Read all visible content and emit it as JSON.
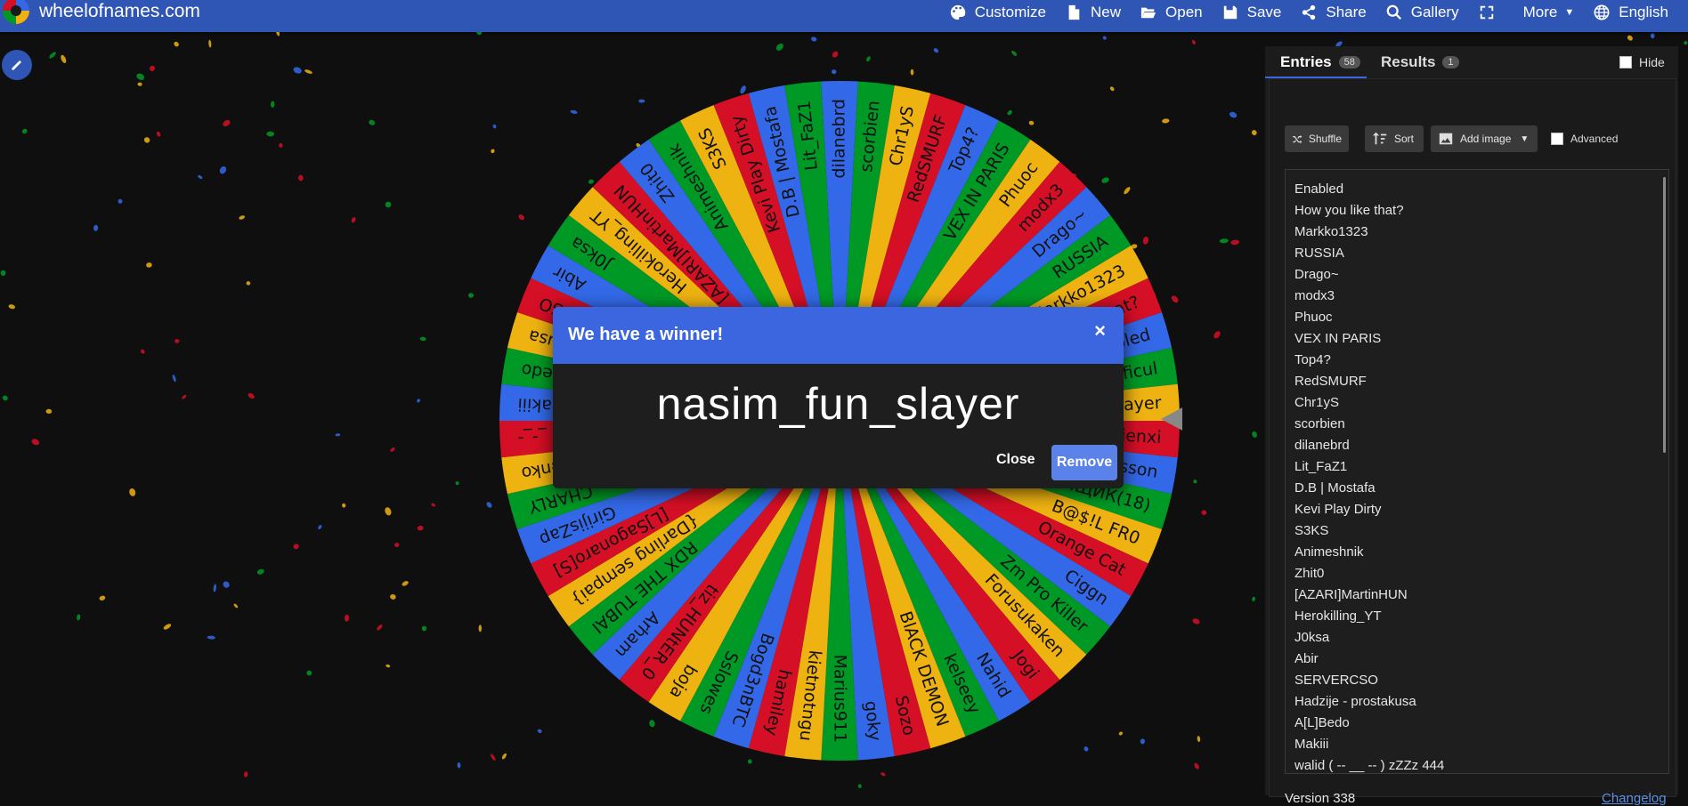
{
  "site": {
    "name": "wheelofnames.com"
  },
  "menu": [
    {
      "label": "Customize",
      "icon": "palette-icon"
    },
    {
      "label": "New",
      "icon": "file-icon"
    },
    {
      "label": "Open",
      "icon": "folder-open-icon"
    },
    {
      "label": "Save",
      "icon": "save-icon"
    },
    {
      "label": "Share",
      "icon": "share-icon"
    },
    {
      "label": "Gallery",
      "icon": "search-icon"
    },
    {
      "label": "",
      "icon": "fullscreen-icon"
    },
    {
      "label": "More",
      "icon": "chevron-down-icon"
    },
    {
      "label": "English",
      "icon": "globe-icon"
    }
  ],
  "colors": {
    "brand": "#2f55b5",
    "wheel": [
      "#3369e8",
      "#009925",
      "#eeb211",
      "#d50f25"
    ],
    "dialog_header": "#3b66e0"
  },
  "wheel": {
    "labels": [
      "dilanebrd",
      "scorbien",
      "Chr1yS",
      "RedSMURF",
      "Top4?",
      "VEX IN PARIS",
      "Phuoc",
      "modx3",
      "Drago~",
      "RUSSIA",
      "Markko1323",
      "How you like that?",
      "Enabled",
      "Magnificul",
      "nasim_fun_slayer",
      "Santienxi",
      "Jonsson",
      "ГОНЩИК(18)",
      "B@$!L FR0",
      "Orange Cat",
      "Ciggn",
      "Zm Pro Killer",
      "Forusukaken",
      "Jogi",
      "Nahid",
      "kelseey",
      "BlACK DEMON",
      "Sozo",
      "goky",
      "Marius911",
      "kietnotngu",
      "hamiley",
      "Bogd3nBTC",
      "Sslowes",
      "boja",
      "tiz_HUNtER_0",
      "Arham",
      "RDX THE TUBAI",
      "{Darling sempai}",
      "[L]Sagonaro[S]",
      "GirijisZap",
      "CHARLY",
      "Kalienko",
      "_-_-",
      "Makiii",
      "A[L]Bedo",
      "Hadzije - prostakusa",
      "SERVERCSO",
      "Abir",
      "J0ksa",
      "Herokilling_YT",
      "[AZARI]MartinHUN",
      "Zhit0",
      "Animeshnik",
      "S3KS",
      "Kevi Play Dirty",
      "D.B | Mostafa",
      "Lit_FaZ1"
    ]
  },
  "dialog": {
    "title": "We have a winner!",
    "close_x": "×",
    "winner": "nasim_fun_slayer",
    "close_label": "Close",
    "remove_label": "Remove"
  },
  "panel": {
    "tabs": [
      {
        "label": "Entries",
        "count": "58"
      },
      {
        "label": "Results",
        "count": "1"
      }
    ],
    "hide_label": "Hide",
    "shuffle_label": "Shuffle",
    "sort_label": "Sort",
    "add_image_label": "Add image",
    "advanced_label": "Advanced",
    "entries": [
      "Enabled",
      "How you like that?",
      "Markko1323",
      "RUSSIA",
      "Drago~",
      "modx3",
      "Phuoc",
      "VEX IN PARIS",
      "Top4?",
      "RedSMURF",
      "Chr1yS",
      "scorbien",
      "dilanebrd",
      "Lit_FaZ1",
      "D.B | Mostafa",
      "Kevi Play Dirty",
      "S3KS",
      "Animeshnik",
      "Zhit0",
      "[AZARI]MartinHUN",
      "Herokilling_YT",
      "J0ksa",
      "Abir",
      "SERVERCSO",
      "Hadzije - prostakusa",
      "A[L]Bedo",
      "Makiii",
      "walid ( -- __ -- ) zZZz 444"
    ],
    "version": "Version 338",
    "changelog": "Changelog"
  }
}
